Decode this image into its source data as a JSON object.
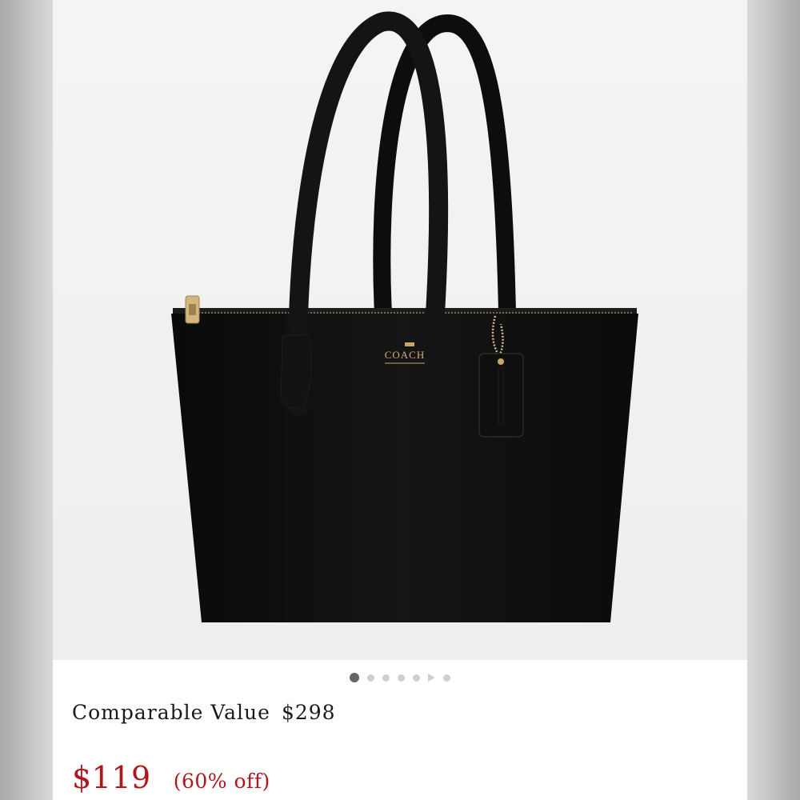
{
  "product": {
    "image_alt": "Black leather tote bag",
    "brand_mark": "COACH",
    "carousel": {
      "total_images": 7,
      "active_index": 0,
      "video_index": 5
    },
    "comparable_label": "Comparable Value",
    "comparable_value": "$298",
    "price": "$119",
    "discount": "(60% off)"
  },
  "colors": {
    "price": "#b0171d",
    "bag": "#111111",
    "hardware": "#c9a66b",
    "background": "#f2f2f2"
  }
}
